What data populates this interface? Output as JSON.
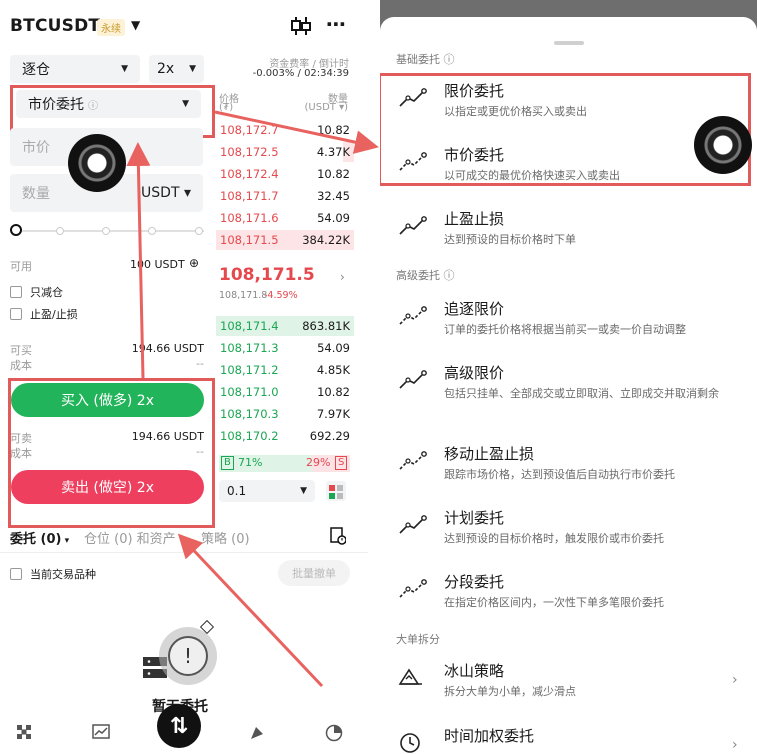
{
  "left": {
    "symbol": "BTCUSDT",
    "badge": "永续",
    "margin_mode": "逐仓",
    "leverage": "2x",
    "funding_label": "资金费率 / 倒计时",
    "funding_value": "-0.003% / 02:34:39",
    "order_type": "市价委托",
    "price_placeholder": "市价",
    "qty_placeholder": "数量",
    "qty_unit": "USDT",
    "available_label": "可用",
    "available_value": "100 USDT",
    "reduce_only": "只减仓",
    "tp_sl": "止盈/止损",
    "buyable_label": "可买",
    "buyable_value": "194.66 USDT",
    "cost_label": "成本",
    "cost_value": "--",
    "buy_button": "买入 (做多) 2x",
    "sellable_label": "可卖",
    "sellable_value": "194.66 USDT",
    "cost2_label": "成本",
    "cost2_value": "--",
    "sell_button": "卖出 (做空) 2x",
    "orderbook": {
      "price_header": "价格",
      "price_unit": "(₮)",
      "qty_header": "数量",
      "qty_unit": "(USDT ▾)",
      "asks": [
        {
          "price": "108,172.7",
          "qty": "10.82"
        },
        {
          "price": "108,172.5",
          "qty": "4.37K"
        },
        {
          "price": "108,172.4",
          "qty": "10.82"
        },
        {
          "price": "108,171.7",
          "qty": "32.45"
        },
        {
          "price": "108,171.6",
          "qty": "54.09"
        },
        {
          "price": "108,171.5",
          "qty": "384.22K"
        }
      ],
      "last_price": "108,171.5",
      "mark_price": "108,171.8",
      "change": "-4.59%",
      "bids": [
        {
          "price": "108,171.4",
          "qty": "863.81K"
        },
        {
          "price": "108,171.3",
          "qty": "54.09"
        },
        {
          "price": "108,171.2",
          "qty": "4.85K"
        },
        {
          "price": "108,171.0",
          "qty": "10.82"
        },
        {
          "price": "108,170.3",
          "qty": "7.97K"
        },
        {
          "price": "108,170.2",
          "qty": "692.29"
        }
      ],
      "b_label": "B",
      "b_pct": "71%",
      "s_pct": "29%",
      "s_label": "S",
      "depth": "0.1"
    },
    "tabs": {
      "orders": "委托 (0)",
      "positions": "仓位 (0) 和资产",
      "strategies": "策略 (0)"
    },
    "current_only": "当前交易品种",
    "batch_cancel": "批量撤单",
    "empty_text": "暂无委托",
    "colors": {
      "buy": "#22b45a",
      "sell": "#ee3f5f",
      "highlight_box": "#e25b5b"
    }
  },
  "right": {
    "section_basic": "基础委托",
    "section_advanced": "高级委托",
    "section_split": "大单拆分",
    "items": [
      {
        "title": "限价委托",
        "desc": "以指定或更优价格买入或卖出"
      },
      {
        "title": "市价委托",
        "desc": "以可成交的最优价格快速买入或卖出"
      },
      {
        "title": "止盈止损",
        "desc": "达到预设的目标价格时下单"
      },
      {
        "title": "追逐限价",
        "desc": "订单的委托价格将根据当前买一或卖一价自动调整"
      },
      {
        "title": "高级限价",
        "desc": "包括只挂单、全部成交或立即取消、立即成交并取消剩余"
      },
      {
        "title": "移动止盈止损",
        "desc": "跟踪市场价格，达到预设值后自动执行市价委托"
      },
      {
        "title": "计划委托",
        "desc": "达到预设的目标价格时，触发限价或市价委托"
      },
      {
        "title": "分段委托",
        "desc": "在指定价格区间内，一次性下单多笔限价委托"
      },
      {
        "title": "冰山策略",
        "desc": "拆分大单为小单，减少滑点"
      },
      {
        "title": "时间加权委托",
        "desc": ""
      }
    ]
  }
}
